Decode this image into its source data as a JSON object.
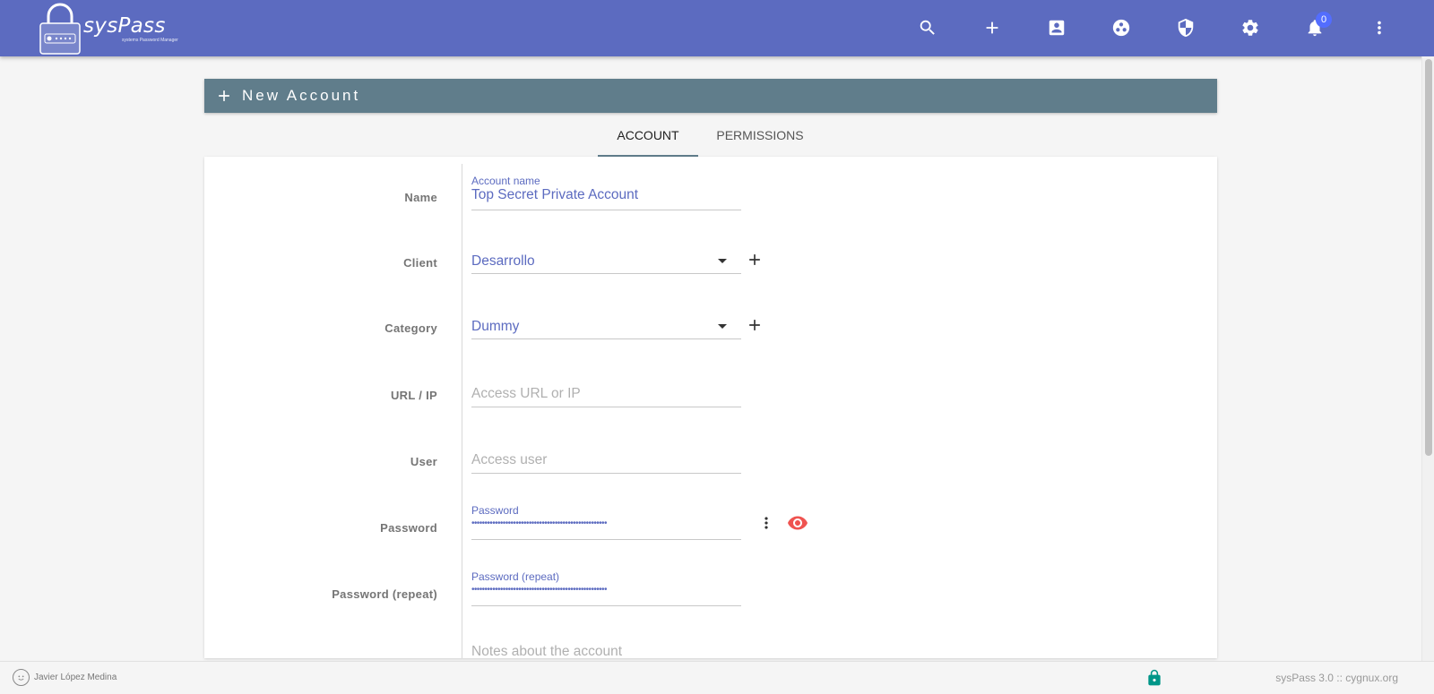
{
  "app": {
    "logo_text": "sysPass",
    "logo_subtitle": "systems Password Manager"
  },
  "colors": {
    "primary": "#5c6bc0",
    "header_bar": "#607d8b",
    "eye_icon": "#ef5350",
    "lock_icon": "#009688",
    "badge": "#536dfe"
  },
  "topbar": {
    "icons": [
      "search-icon",
      "add-icon",
      "account-box-icon",
      "groups-icon",
      "security-shield-icon",
      "settings-icon",
      "notifications-icon",
      "more-vert-icon"
    ],
    "notification_count": "0"
  },
  "page": {
    "title": "New Account"
  },
  "tabs": [
    {
      "label": "ACCOUNT",
      "active": true
    },
    {
      "label": "PERMISSIONS",
      "active": false
    }
  ],
  "form": {
    "name": {
      "label": "Name",
      "float_label": "Account name",
      "value": "Top Secret Private Account"
    },
    "client": {
      "label": "Client",
      "value": "Desarrollo"
    },
    "category": {
      "label": "Category",
      "value": "Dummy"
    },
    "url": {
      "label": "URL / IP",
      "placeholder": "Access URL or IP"
    },
    "user": {
      "label": "User",
      "placeholder": "Access user"
    },
    "password": {
      "label": "Password",
      "float_label": "Password",
      "masked": "••••••••••••••••••••••••••••••••••••••••••••••••••••"
    },
    "password_repeat": {
      "label": "Password (repeat)",
      "float_label": "Password (repeat)",
      "masked": "••••••••••••••••••••••••••••••••••••••••••••••••••••"
    },
    "notes": {
      "placeholder": "Notes about the account"
    }
  },
  "footer": {
    "user_name": "Javier López Medina",
    "version_text": "sysPass 3.0  ::  cygnux.org"
  }
}
